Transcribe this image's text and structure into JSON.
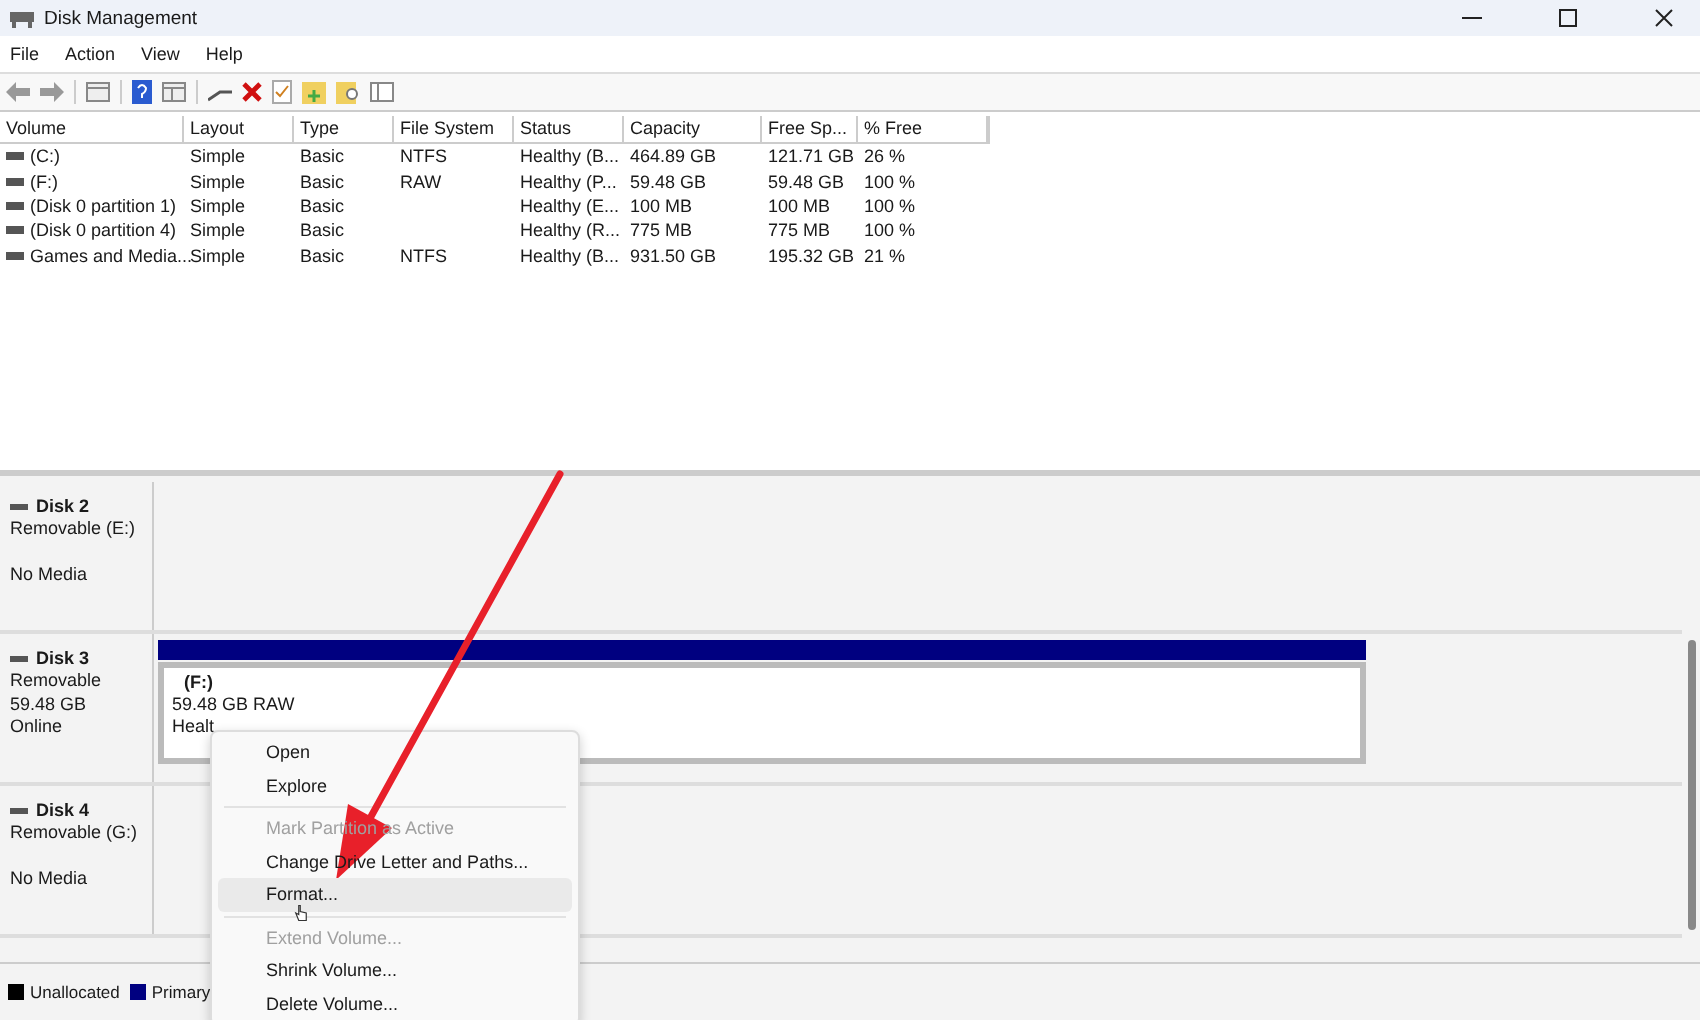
{
  "window": {
    "title": "Disk Management"
  },
  "menu": [
    "File",
    "Action",
    "View",
    "Help"
  ],
  "table": {
    "columns": [
      "Volume",
      "Layout",
      "Type",
      "File System",
      "Status",
      "Capacity",
      "Free Sp...",
      "% Free"
    ],
    "rows": [
      [
        "(C:)",
        "Simple",
        "Basic",
        "NTFS",
        "Healthy (B...",
        "464.89 GB",
        "121.71 GB",
        "26 %"
      ],
      [
        "(F:)",
        "Simple",
        "Basic",
        "RAW",
        "Healthy (P...",
        "59.48 GB",
        "59.48 GB",
        "100 %"
      ],
      [
        "(Disk 0 partition 1)",
        "Simple",
        "Basic",
        "",
        "Healthy (E...",
        "100 MB",
        "100 MB",
        "100 %"
      ],
      [
        "(Disk 0 partition 4)",
        "Simple",
        "Basic",
        "",
        "Healthy (R...",
        "775 MB",
        "775 MB",
        "100 %"
      ],
      [
        "Games and Media...",
        "Simple",
        "Basic",
        "NTFS",
        "Healthy (B...",
        "931.50 GB",
        "195.32 GB",
        "21 %"
      ]
    ]
  },
  "disks": [
    {
      "name": "Disk 2",
      "type": "Removable (E:)",
      "status": "No Media"
    },
    {
      "name": "Disk 3",
      "type": "Removable",
      "size": "59.48 GB",
      "status": "Online",
      "partition": {
        "title": "(F:)",
        "size": "59.48 GB RAW",
        "status": "Healt"
      }
    },
    {
      "name": "Disk 4",
      "type": "Removable (G:)",
      "status": "No Media"
    }
  ],
  "legend": [
    {
      "label": "Unallocated",
      "color": "#000000"
    },
    {
      "label": "Primary",
      "color": "#000080"
    }
  ],
  "context_menu": [
    {
      "label": "Open",
      "disabled": false,
      "selected": false
    },
    {
      "label": "Explore",
      "disabled": false,
      "selected": false,
      "separator_after": true
    },
    {
      "label": "Mark Partition as Active",
      "disabled": true,
      "selected": false
    },
    {
      "label": "Change Drive Letter and Paths...",
      "disabled": false,
      "selected": false
    },
    {
      "label": "Format...",
      "disabled": false,
      "selected": true,
      "separator_after": true
    },
    {
      "label": "Extend Volume...",
      "disabled": true,
      "selected": false
    },
    {
      "label": "Shrink Volume...",
      "disabled": false,
      "selected": false
    },
    {
      "label": "Delete Volume...",
      "disabled": false,
      "selected": false
    }
  ]
}
